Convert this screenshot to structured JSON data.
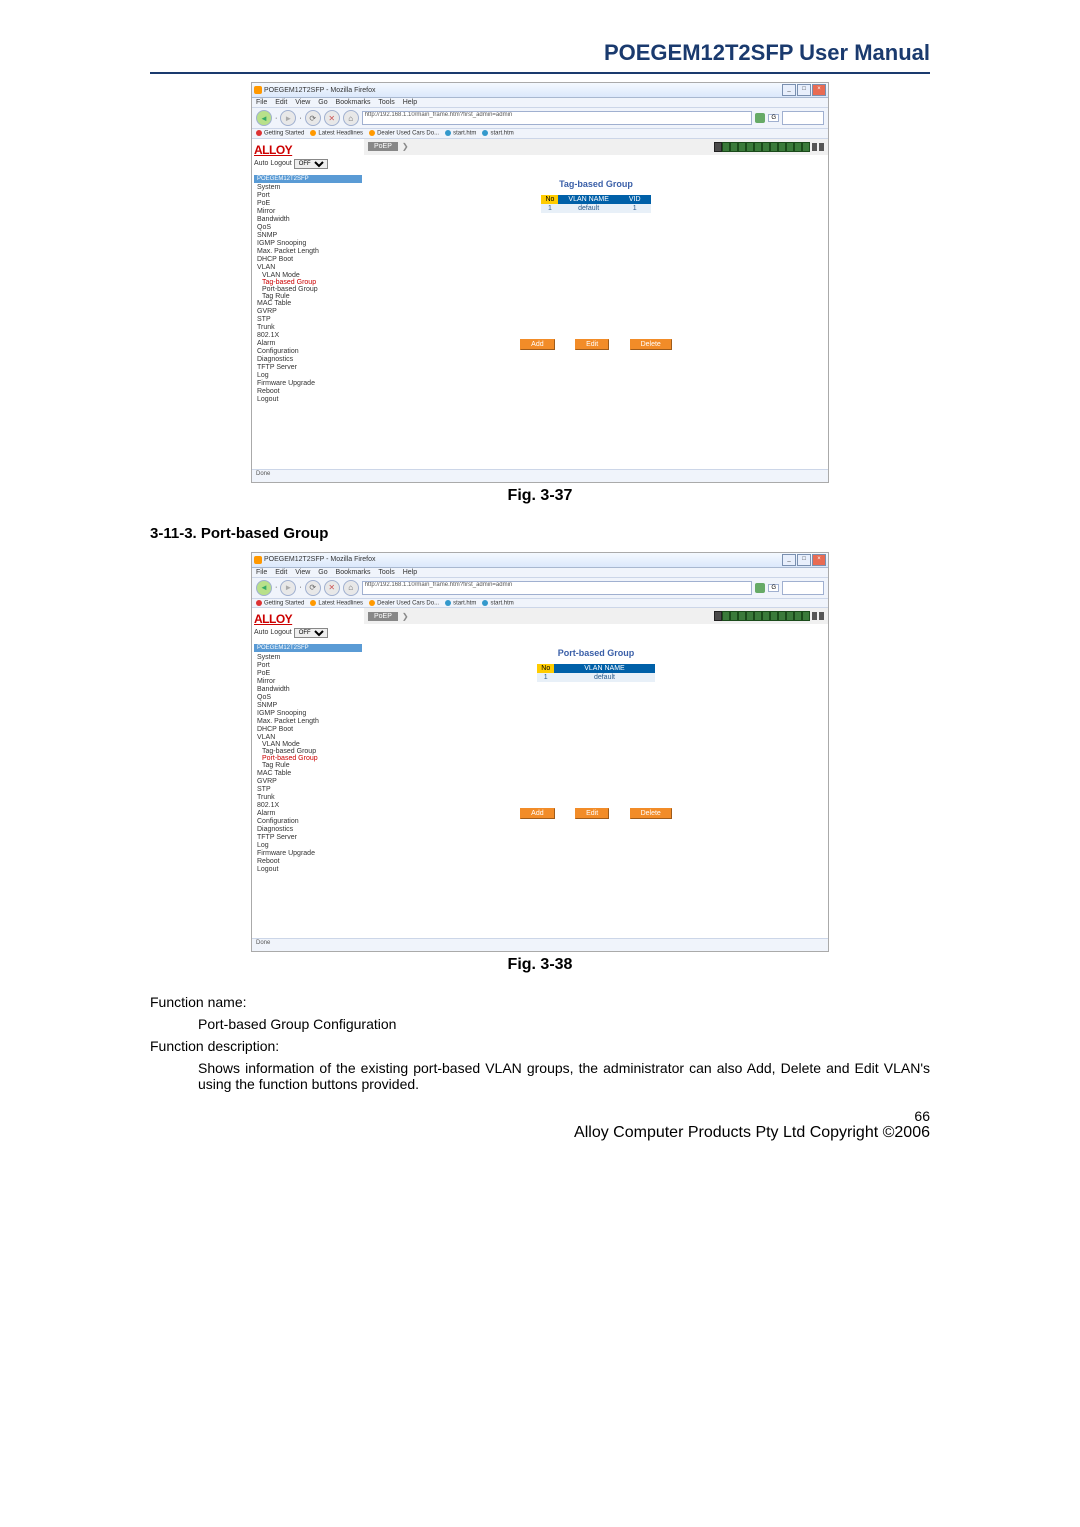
{
  "header": {
    "title": "POEGEM12T2SFP User Manual"
  },
  "browser": {
    "window_title": "POEGEM12T2SFP - Mozilla Firefox",
    "menubar": [
      "File",
      "Edit",
      "View",
      "Go",
      "Bookmarks",
      "Tools",
      "Help"
    ],
    "url": "http://192.168.1.10/main_frame.htm?first_admin=admin",
    "search_engine": "G",
    "bookmarks": [
      "Getting Started",
      "Latest Headlines",
      "Dealer Used Cars Do...",
      "start.htm",
      "start.htm"
    ]
  },
  "sidebar": {
    "logo": "ALLOY",
    "auto_logout_label": "Auto Logout",
    "auto_logout_value": "OFF",
    "model_header": "POEGEM12T2SFP",
    "items": [
      "System",
      "Port",
      "PoE",
      "Mirror",
      "Bandwidth",
      "QoS",
      "SNMP",
      "IGMP Snooping",
      "Max. Packet Length",
      "DHCP Boot",
      "VLAN"
    ],
    "vlan_sub": [
      "VLAN Mode",
      "Tag-based Group",
      "Port-based Group",
      "Tag Rule"
    ],
    "items_after": [
      "MAC Table",
      "GVRP",
      "STP",
      "Trunk",
      "802.1X",
      "Alarm",
      "Configuration",
      "Diagnostics",
      "TFTP Server",
      "Log",
      "Firmware Upgrade",
      "Reboot",
      "Logout"
    ]
  },
  "fig37": {
    "top_tab": "PoEP",
    "title": "Tag-based Group",
    "table": {
      "headers": [
        "No",
        "VLAN NAME",
        "VID"
      ],
      "rows": [
        [
          "1",
          "default",
          "1"
        ]
      ]
    },
    "buttons": [
      "Add",
      "Edit",
      "Delete"
    ],
    "status": "Done",
    "caption": "Fig. 3-37",
    "active_sub": "Tag-based Group"
  },
  "fig38": {
    "top_tab": "PoEP",
    "title": "Port-based Group",
    "table": {
      "headers": [
        "No",
        "VLAN NAME"
      ],
      "rows": [
        [
          "1",
          "default"
        ]
      ]
    },
    "buttons": [
      "Add",
      "Edit",
      "Delete"
    ],
    "status": "Done",
    "caption": "Fig. 3-38",
    "active_sub": "Port-based Group"
  },
  "section": {
    "heading": "3-11-3. Port-based Group",
    "fn_name_label": "Function name:",
    "fn_name": "Port-based Group Configuration",
    "fn_desc_label": "Function description:",
    "fn_desc": "Shows information of the existing port-based VLAN groups, the administrator can also Add, Delete and Edit VLAN's using the function buttons provided."
  },
  "footer": {
    "page": "66",
    "copyright": "Alloy Computer Products Pty Ltd Copyright ©2006"
  }
}
